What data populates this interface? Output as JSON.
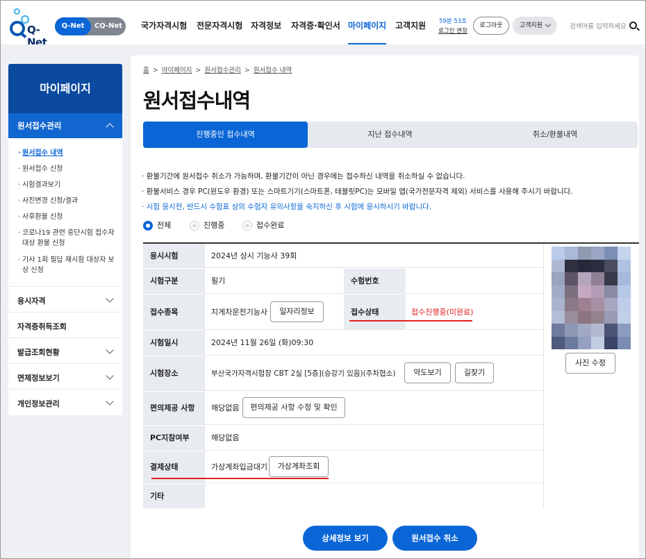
{
  "header": {
    "logo_text": "Q-Net",
    "switch": {
      "active": "Q-Net",
      "inactive": "CQ-Net"
    },
    "gnb": [
      "국가자격시험",
      "전문자격시험",
      "자격정보",
      "자격증·확인서",
      "마이페이지",
      "고객지원"
    ],
    "session_time": "59분 53초",
    "session_extend": "로그인 연장",
    "logout": "로그아웃",
    "support": "고객지원",
    "search_placeholder": "검색어를 입력하세요"
  },
  "sidebar": {
    "title": "마이페이지",
    "current_group": "원서접수관리",
    "sub_items": [
      "원서접수 내역",
      "원서접수 신청",
      "시험결과보기",
      "사진변경 신청/결과",
      "사후환불 신청",
      "코로나19 관련 중단시험 접수자 대상 환불 신청",
      "기사 1회 필답 재시험 대상자 보상 신청"
    ],
    "groups": [
      "응시자격",
      "자격증취득조회",
      "발급조회현황",
      "면제정보보기",
      "개인정보관리"
    ]
  },
  "breadcrumb": [
    "홈",
    "마이페이지",
    "원서접수관리",
    "원서접수 내역"
  ],
  "page_title": "원서접수내역",
  "tabs": [
    "진행중인 접수내역",
    "지난 접수내역",
    "취소/환불내역"
  ],
  "notices": [
    "환불기간에 원서접수 취소가 가능하며, 환불기간이 아닌 경우에는 접수하신 내역을 취소하실 수 없습니다.",
    "환불서비스 경우 PC(윈도우 환경) 또는 스마트기기(스마트폰, 테블릿PC)는 모바일 앱(국가전문자격 제외) 서비스를 사용해 주시기 바랍니다.",
    "시험 응시전, 반드시 수험표 상의 수험자 유의사항을 숙지하신 후 시험에 응시하시기 바랍니다."
  ],
  "filters": [
    "전체",
    "진행중",
    "접수완료"
  ],
  "table": {
    "exam_label": "응시시험",
    "exam_value": "2024년 상시 기능사 39회",
    "type_label": "시험구분",
    "type_value": "필기",
    "examno_label": "수험번호",
    "examno_value": "",
    "field_label": "접수종목",
    "field_value": "지게차운전기능사",
    "job_button": "일자리정보",
    "status_label": "접수상태",
    "status_value": "접수진행중(미완료)",
    "date_label": "시험일시",
    "date_value": "2024년 11월 26일 (화)09:30",
    "place_label": "시험장소",
    "place_value": "부산국가자격시험장 CBT 2실 [5층](승강기 있음)(주차협소)",
    "map_button": "약도보기",
    "route_button": "길찾기",
    "conv_label": "편의제공 사항",
    "conv_value": "해당없음",
    "conv_button": "편의제공 사항 수정 및 확인",
    "pc_label": "PC지참여부",
    "pc_value": "해당없음",
    "pay_label": "결제상태",
    "pay_value": "가상계좌입금대기",
    "pay_button": "가상계좌조회",
    "etc_label": "기타",
    "etc_value": ""
  },
  "photo_button": "사진 수정",
  "buttons": {
    "detail": "상세정보 보기",
    "cancel": "원서접수 취소"
  },
  "colors": {
    "primary": "#0a66d6",
    "sidebar_top": "#0b4a9f",
    "status_red": "#e02020"
  }
}
